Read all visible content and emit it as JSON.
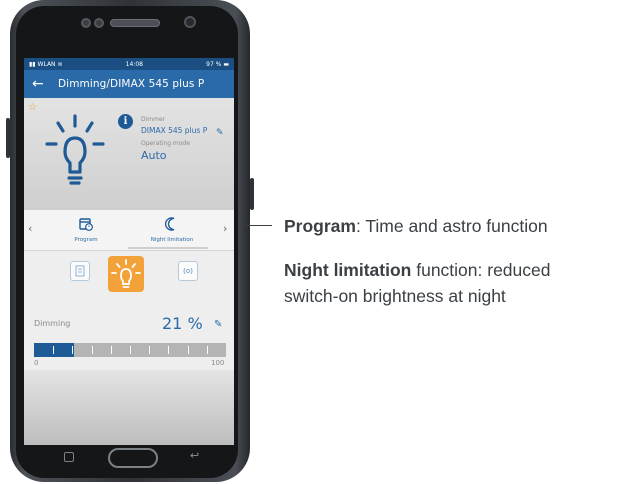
{
  "status": {
    "carrier": "WLAN",
    "time": "14:08",
    "battery": "97 %"
  },
  "appbar": {
    "title": "Dimming/DIMAX 545 plus P"
  },
  "device": {
    "type_label": "Dimmer",
    "name": "DIMAX 545 plus P",
    "mode_label": "Operating mode",
    "mode_value": "Auto",
    "favorite": true
  },
  "tabs": [
    {
      "label": "Program",
      "icon": "calendar-clock-icon"
    },
    {
      "label": "Night limitation",
      "icon": "moon-icon",
      "active": true
    }
  ],
  "modes": [
    "sensor-mode-icon",
    "light-bulb-icon",
    "remote-mode-icon"
  ],
  "dimming": {
    "label": "Dimming",
    "value": "21 %",
    "level_percent": 21,
    "min": "0",
    "max": "100"
  },
  "annotations": {
    "program_bold": "Program",
    "program_rest": ": Time and astro function",
    "night_bold": "Night limitation",
    "night_rest": " function: reduced",
    "night_line2": "switch-on brightness at night"
  },
  "colors": {
    "primary": "#2a6aa8",
    "accent": "#f3a23a"
  }
}
